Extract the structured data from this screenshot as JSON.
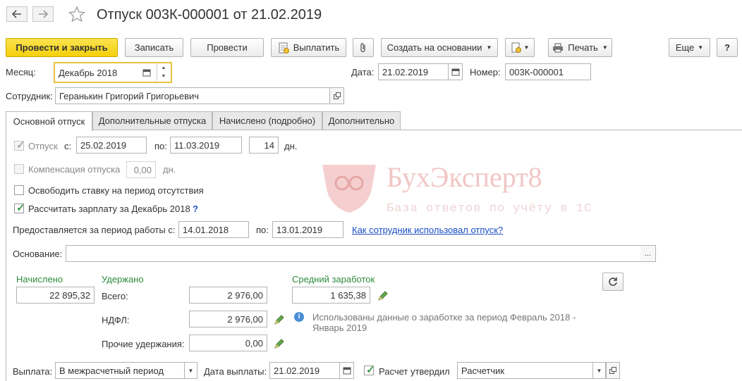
{
  "window": {
    "title": "Отпуск 003К-000001 от 21.02.2019"
  },
  "toolbar": {
    "post_close": "Провести и закрыть",
    "save": "Записать",
    "post": "Провести",
    "pay": "Выплатить",
    "create_based": "Создать на основании",
    "print": "Печать",
    "more": "Еще",
    "help": "?"
  },
  "header": {
    "month_label": "Месяц:",
    "month_value": "Декабрь 2018",
    "date_label": "Дата:",
    "date_value": "21.02.2019",
    "number_label": "Номер:",
    "number_value": "003К-000001",
    "employee_label": "Сотрудник:",
    "employee_value": "Геранькин Григорий Григорьевич"
  },
  "tabs": [
    {
      "label": "Основной отпуск"
    },
    {
      "label": "Дополнительные отпуска"
    },
    {
      "label": "Начислено (подробно)"
    },
    {
      "label": "Дополнительно"
    }
  ],
  "vacation": {
    "label": "Отпуск",
    "from_label": "с:",
    "from": "25.02.2019",
    "to_label": "по:",
    "to": "11.03.2019",
    "days": "14",
    "days_unit": "дн.",
    "checked": true
  },
  "compensation": {
    "label": "Компенсация отпуска",
    "value": "0,00",
    "unit": "дн.",
    "checked": false
  },
  "free_rate": {
    "label": "Освободить ставку на период отсутствия",
    "checked": false
  },
  "calc_salary": {
    "label": "Рассчитать зарплату за Декабрь 2018",
    "help": "?",
    "checked": true
  },
  "work_period": {
    "label": "Предоставляется за период работы с:",
    "from": "14.01.2018",
    "to_label": "по:",
    "to": "13.01.2019",
    "link": "Как сотрудник использовал отпуск?"
  },
  "basis": {
    "label": "Основание:",
    "value": "",
    "button": "..."
  },
  "accrued": {
    "label": "Начислено",
    "value": "22 895,32"
  },
  "withheld": {
    "label": "Удержано",
    "total_label": "Всего:",
    "total": "2 976,00",
    "ndfl_label": "НДФЛ:",
    "ndfl": "2 976,00",
    "other_label": "Прочие удержания:",
    "other": "0,00"
  },
  "avg_earnings": {
    "label": "Средний заработок",
    "value": "1 635,38",
    "info": "Использованы данные о заработке за период Февраль 2018 - Январь 2019"
  },
  "payment": {
    "label": "Выплата:",
    "value": "В межрасчетный период",
    "date_label": "Дата выплаты:",
    "date": "21.02.2019",
    "approved_label": "Расчет утвердил",
    "approved_checked": true,
    "approver": "Расчетчик"
  },
  "watermark": {
    "brand": "БухЭксперт8",
    "tagline": "База ответов по учёту в 1С"
  },
  "colors": {
    "primary_button": "#f5d00c",
    "section_label_green": "#2e8b3d",
    "link_blue": "#1a4fc4",
    "watermark_red": "#e8a0a0",
    "focus_border": "#e8c23a"
  }
}
